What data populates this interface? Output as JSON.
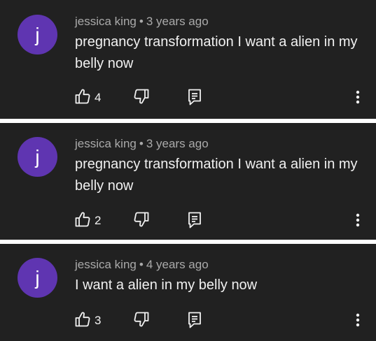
{
  "comments": [
    {
      "avatar_letter": "j",
      "author": "jessica king",
      "separator": "•",
      "time": "3 years ago",
      "text": "pregnancy transformation  I want  a  alien in my belly now",
      "likes": "4"
    },
    {
      "avatar_letter": "j",
      "author": "jessica king",
      "separator": "•",
      "time": "3 years ago",
      "text": "pregnancy transformation I want a alien in my belly now",
      "likes": "2"
    },
    {
      "avatar_letter": "j",
      "author": "jessica king",
      "separator": "•",
      "time": "4 years ago",
      "text": "I want a alien in my belly now",
      "likes": "3"
    }
  ],
  "icons": {
    "like": "thumbs-up-icon",
    "dislike": "thumbs-down-icon",
    "reply": "reply-icon",
    "more": "more-vertical-icon"
  },
  "colors": {
    "background": "#212121",
    "avatar": "#5f35b1",
    "text": "#f1f1f1",
    "secondary_text": "#aaaaaa",
    "divider": "#ffffff"
  }
}
